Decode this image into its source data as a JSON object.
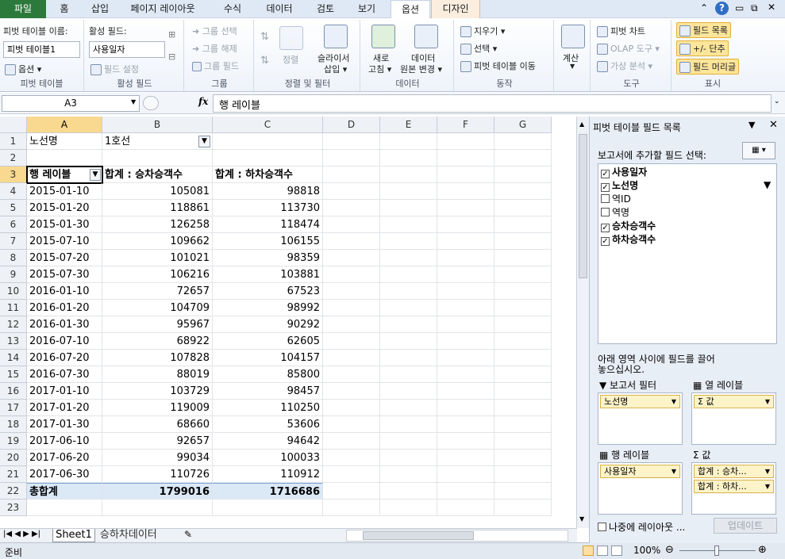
{
  "tabs": [
    "파일",
    "홈",
    "삽입",
    "페이지 레이아웃",
    "수식",
    "데이터",
    "검토",
    "보기",
    "옵션",
    "디자인"
  ],
  "ribbon": {
    "pivot": {
      "name_label": "피벗 테이블 이름:",
      "name_value": "피벗 테이블1",
      "options_label": "옵션 ▾",
      "group": "피벗 테이블"
    },
    "active_field": {
      "label": "활성 필드:",
      "value": "사용일자",
      "settings": "필드 설정",
      "group": "활성 필드"
    },
    "group": {
      "select": "그룹 선택",
      "ungroup": "그룹 해제",
      "field": "그룹 필드",
      "group": "그룹"
    },
    "sort": {
      "sort": "정렬",
      "slicer_1": "슬라이서",
      "slicer_2": "삽입 ▾",
      "group": "정렬 및 필터"
    },
    "data": {
      "refresh_1": "새로",
      "refresh_2": "고침 ▾",
      "source_1": "데이터",
      "source_2": "원본 변경 ▾",
      "group": "데이터"
    },
    "actions": {
      "clear": "지우기 ▾",
      "select": "선택 ▾",
      "move": "피벗 테이블 이동",
      "group": "동작"
    },
    "calc": {
      "label": "계산"
    },
    "tools": {
      "chart": "피벗 차트",
      "olap": "OLAP 도구 ▾",
      "whatif": "가상 분석 ▾",
      "group": "도구"
    },
    "show": {
      "fieldlist": "필드 목록",
      "buttons": "+/- 단추",
      "headers": "필드 머리글",
      "group": "표시"
    }
  },
  "formula_bar": {
    "cell_ref": "A3",
    "fx": "fx",
    "content": "행 레이블"
  },
  "columns": [
    "A",
    "B",
    "C",
    "D",
    "E",
    "F",
    "G"
  ],
  "rows": [
    {
      "n": "1",
      "a": "노선명",
      "b": "1호선",
      "c": "",
      "filter": true
    },
    {
      "n": "2",
      "a": "",
      "b": "",
      "c": ""
    },
    {
      "n": "3",
      "a": "행 레이블",
      "b": "합계 : 승차승객수",
      "c": "합계 : 하차승객수",
      "header": true
    },
    {
      "n": "4",
      "a": "2015-01-10",
      "b": "105081",
      "c": "98818"
    },
    {
      "n": "5",
      "a": "2015-01-20",
      "b": "118861",
      "c": "113730"
    },
    {
      "n": "6",
      "a": "2015-01-30",
      "b": "126258",
      "c": "118474"
    },
    {
      "n": "7",
      "a": "2015-07-10",
      "b": "109662",
      "c": "106155"
    },
    {
      "n": "8",
      "a": "2015-07-20",
      "b": "101021",
      "c": "98359"
    },
    {
      "n": "9",
      "a": "2015-07-30",
      "b": "106216",
      "c": "103881"
    },
    {
      "n": "10",
      "a": "2016-01-10",
      "b": "72657",
      "c": "67523"
    },
    {
      "n": "11",
      "a": "2016-01-20",
      "b": "104709",
      "c": "98992"
    },
    {
      "n": "12",
      "a": "2016-01-30",
      "b": "95967",
      "c": "90292"
    },
    {
      "n": "13",
      "a": "2016-07-10",
      "b": "68922",
      "c": "62605"
    },
    {
      "n": "14",
      "a": "2016-07-20",
      "b": "107828",
      "c": "104157"
    },
    {
      "n": "15",
      "a": "2016-07-30",
      "b": "88019",
      "c": "85800"
    },
    {
      "n": "16",
      "a": "2017-01-10",
      "b": "103729",
      "c": "98457"
    },
    {
      "n": "17",
      "a": "2017-01-20",
      "b": "119009",
      "c": "110250"
    },
    {
      "n": "18",
      "a": "2017-01-30",
      "b": "68660",
      "c": "53606"
    },
    {
      "n": "19",
      "a": "2017-06-10",
      "b": "92657",
      "c": "94642"
    },
    {
      "n": "20",
      "a": "2017-06-20",
      "b": "99034",
      "c": "100033"
    },
    {
      "n": "21",
      "a": "2017-06-30",
      "b": "110726",
      "c": "110912"
    },
    {
      "n": "22",
      "a": "총합계",
      "b": "1799016",
      "c": "1716686",
      "total": true
    },
    {
      "n": "23",
      "a": "",
      "b": "",
      "c": ""
    }
  ],
  "sheets": [
    "Sheet1",
    "승하차데이터"
  ],
  "status": {
    "ready": "준비",
    "zoom": "100%"
  },
  "field_panel": {
    "title": "피벗 테이블 필드 목록",
    "choose": "보고서에 추가할 필드 선택:",
    "fields": [
      {
        "name": "사용일자",
        "checked": true
      },
      {
        "name": "노선명",
        "checked": true,
        "filtered": true
      },
      {
        "name": "역ID",
        "checked": false
      },
      {
        "name": "역명",
        "checked": false
      },
      {
        "name": "승차승객수",
        "checked": true
      },
      {
        "name": "하차승객수",
        "checked": true
      }
    ],
    "drag_hint_1": "아래 영역 사이에 필드를 끌어",
    "drag_hint_2": "놓으십시오.",
    "report_filter": "보고서 필터",
    "col_labels": "열 레이블",
    "row_labels": "행 레이블",
    "values": "값",
    "filter_chip": "노선명",
    "col_chip": "Σ 값",
    "row_chip": "사용일자",
    "value_chip_1": "합계 : 승차...",
    "value_chip_2": "합계 : 하차...",
    "defer": "나중에 레이아웃 ...",
    "update": "업데이트"
  }
}
